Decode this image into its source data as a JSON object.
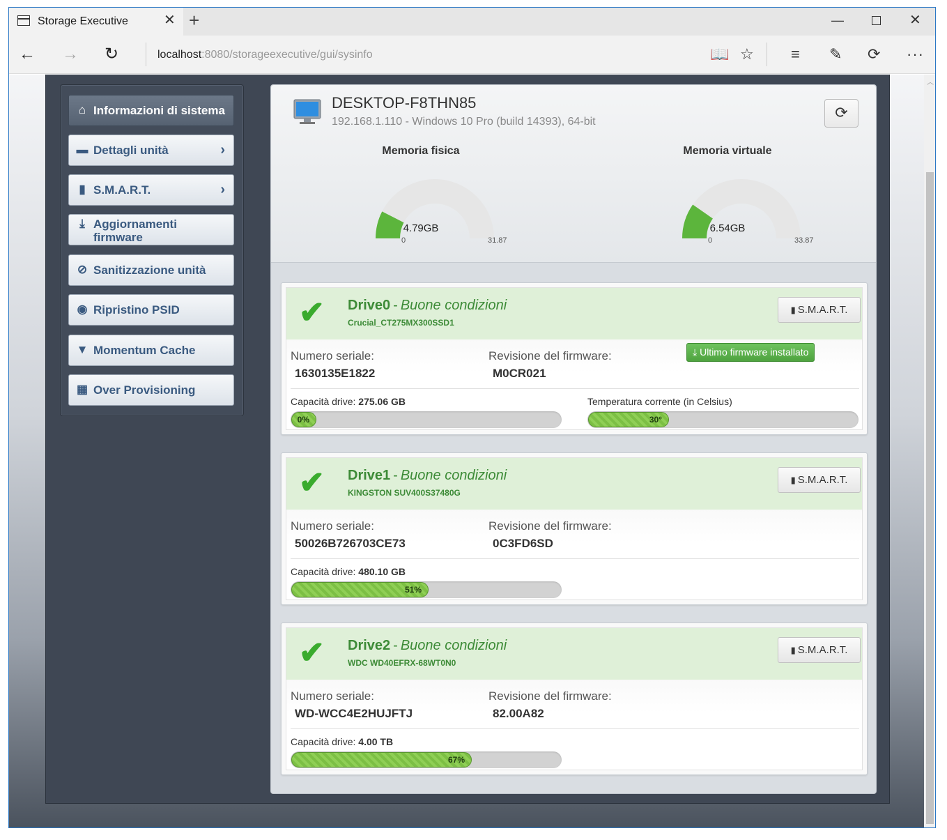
{
  "browser": {
    "tab_title": "Storage Executive",
    "url_host": "localhost",
    "url_rest": ":8080/storageexecutive/gui/sysinfo"
  },
  "sidebar": {
    "items": [
      {
        "label": "Informazioni di sistema",
        "icon": "home-icon",
        "active": true
      },
      {
        "label": "Dettagli unità",
        "icon": "drive-icon",
        "chevron": true
      },
      {
        "label": "S.M.A.R.T.",
        "icon": "bar-chart-icon",
        "chevron": true
      },
      {
        "label": "Aggiornamenti firmware",
        "icon": "download-icon"
      },
      {
        "label": "Sanitizzazione unità",
        "icon": "ban-icon"
      },
      {
        "label": "Ripristino PSID",
        "icon": "eye-slash-icon"
      },
      {
        "label": "Momentum Cache",
        "icon": "filter-icon"
      },
      {
        "label": "Over Provisioning",
        "icon": "grid-icon"
      }
    ]
  },
  "system": {
    "hostname": "DESKTOP-F8THN85",
    "info": "192.168.1.110 - Windows 10 Pro (build 14393), 64-bit"
  },
  "memory": {
    "physical": {
      "title": "Memoria fisica",
      "value_label": "4.79GB",
      "value": 4.79,
      "min": 0,
      "max": 31.87,
      "min_label": "0",
      "max_label": "31.87"
    },
    "virtual": {
      "title": "Memoria virtuale",
      "value_label": "6.54GB",
      "value": 6.54,
      "min": 0,
      "max": 33.87,
      "min_label": "0",
      "max_label": "33.87"
    }
  },
  "labels": {
    "status_sep": "-",
    "serial": "Numero seriale:",
    "firmware": "Revisione del firmware:",
    "capacity": "Capacità drive:",
    "temperature": "Temperatura corrente (in Celsius)",
    "smart_button": "S.M.A.R.T.",
    "fw_latest": "Ultimo firmware installato"
  },
  "drives": [
    {
      "name": "Drive0",
      "status": "Buone condizioni",
      "model": "Crucial_CT275MX300SSD1",
      "serial": "1630135E1822",
      "firmware": "M0CR021",
      "capacity": "275.06 GB",
      "used_pct": 0,
      "used_label": "0%",
      "temp": 30,
      "temp_label": "30°"
    },
    {
      "name": "Drive1",
      "status": "Buone condizioni",
      "model": "KINGSTON SUV400S37480G",
      "serial": "50026B726703CE73",
      "firmware": "0C3FD6SD",
      "capacity": "480.10 GB",
      "used_pct": 51,
      "used_label": "51%"
    },
    {
      "name": "Drive2",
      "status": "Buone condizioni",
      "model": "WDC WD40EFRX-68WT0N0",
      "serial": "WD-WCC4E2HUJFTJ",
      "firmware": "82.00A82",
      "capacity": "4.00 TB",
      "used_pct": 67,
      "used_label": "67%"
    }
  ],
  "colors": {
    "accent_green": "#3aab2e",
    "gauge_fill": "#5cb53c",
    "gauge_track": "#e6e6e6"
  }
}
